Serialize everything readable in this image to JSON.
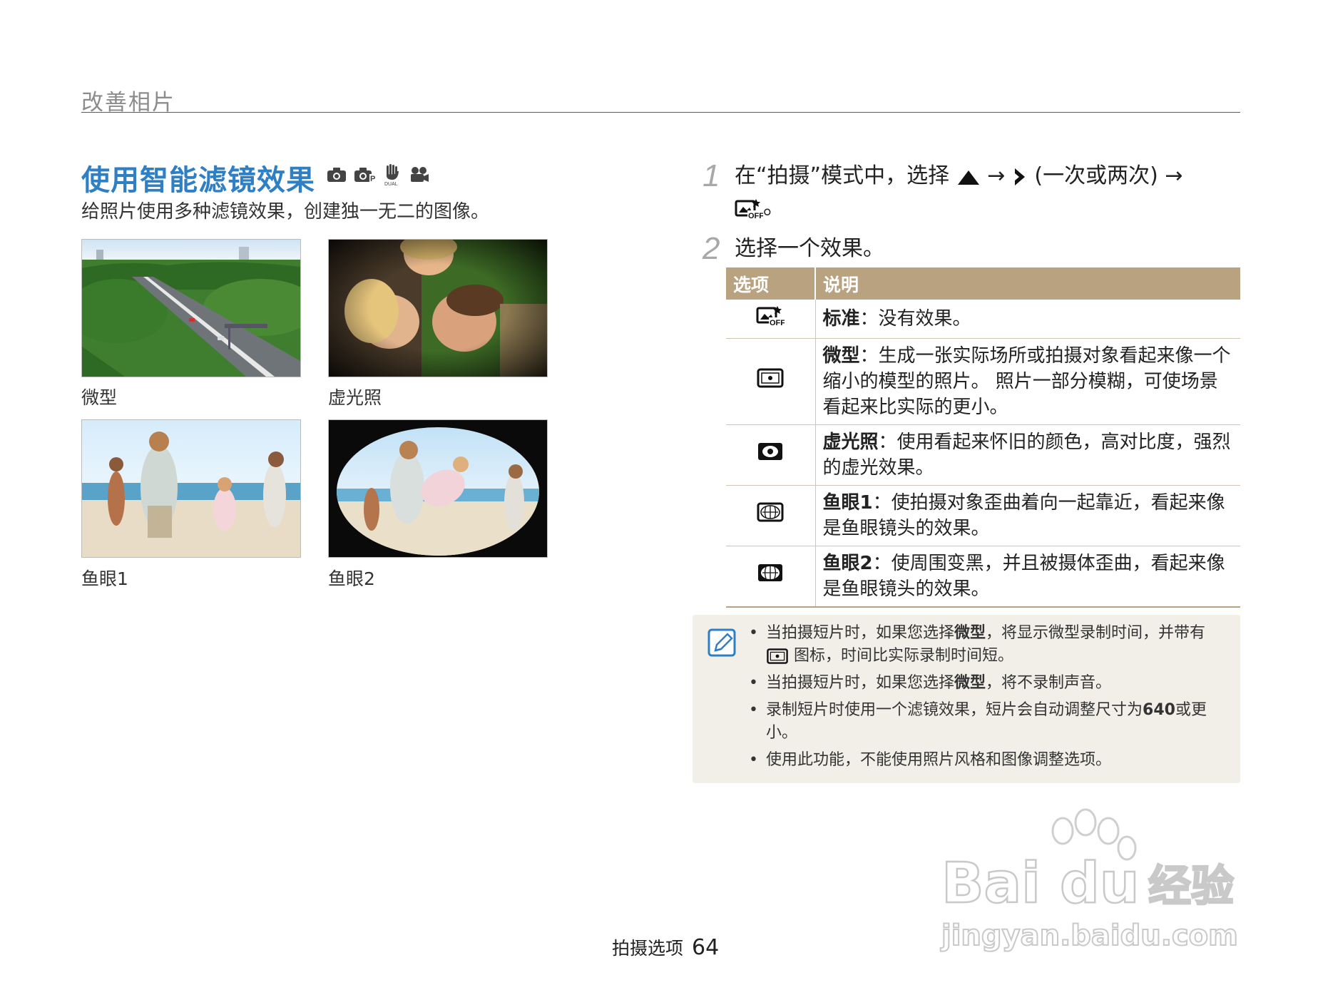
{
  "header": {
    "section": "改善相片"
  },
  "left": {
    "title": "使用智能滤镜效果",
    "mode_icons": [
      "camera-icon",
      "program-camera-icon",
      "dual-is-icon",
      "movie-icon"
    ],
    "intro": "给照片使用多种滤镜效果，创建独一无二的图像。",
    "photos": [
      {
        "caption": "微型"
      },
      {
        "caption": "虚光照"
      },
      {
        "caption": "鱼眼1"
      },
      {
        "caption": "鱼眼2"
      }
    ]
  },
  "steps": [
    {
      "num": "1",
      "pre": "在“拍摄”模式中，选择",
      "arrow1": "→",
      "middle": "(一次或两次)",
      "arrow2": "→",
      "end": "。"
    },
    {
      "num": "2",
      "text": "选择一个效果。"
    }
  ],
  "table": {
    "headers": [
      "选项",
      "说明"
    ],
    "rows": [
      {
        "icon": "filter-off-icon",
        "name": "标准",
        "desc": "：没有效果。"
      },
      {
        "icon": "miniature-icon",
        "name": "微型",
        "desc": "：生成一张实际场所或拍摄对象看起来像一个缩小的模型的照片。 照片一部分模糊，可使场景看起来比实际的更小。"
      },
      {
        "icon": "vignetting-icon",
        "name": "虚光照",
        "desc": "：使用看起来怀旧的颜色，高对比度，强烈的虚光效果。"
      },
      {
        "icon": "fisheye1-icon",
        "name": "鱼眼1",
        "desc": "：使拍摄对象歪曲着向一起靠近，看起来像是鱼眼镜头的效果。"
      },
      {
        "icon": "fisheye2-icon",
        "name": "鱼眼2",
        "desc": "：使周围变黑，并且被摄体歪曲，看起来像是鱼眼镜头的效果。"
      }
    ]
  },
  "notes": [
    {
      "pre": "当拍摄短片时，如果您选择",
      "bold": "微型",
      "post": "，将显示微型录制时间，并带有",
      "post2": "图标，时间比实际录制时间短。"
    },
    {
      "pre": "当拍摄短片时，如果您选择",
      "bold": "微型",
      "post": "，将不录制声音。"
    },
    {
      "pre": "录制短片时使用一个滤镜效果，短片会自动调整尺寸为",
      "bold": "640",
      "post": "或更小。"
    },
    {
      "pre": "使用此功能，不能使用照片风格和图像调整选项。"
    }
  ],
  "footer": {
    "label": "拍摄选项",
    "page": "64"
  },
  "watermark": {
    "brand": "Bai du",
    "cn": "经验",
    "url": "jingyan.baidu.com"
  },
  "colors": {
    "title_blue": "#2f7fc4",
    "table_header": "#b9a280",
    "note_bg": "#f2efe9"
  }
}
